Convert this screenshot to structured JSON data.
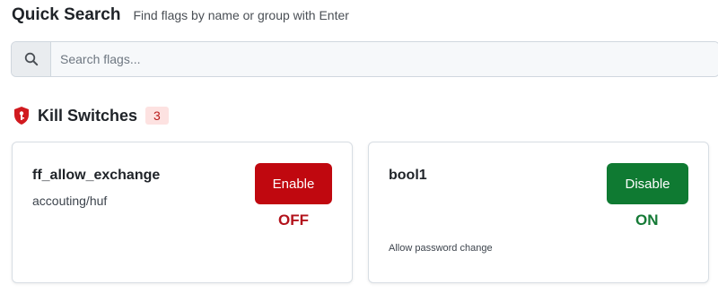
{
  "header": {
    "title": "Quick Search",
    "subtitle": "Find flags by name or group with Enter"
  },
  "search": {
    "icon": "search-icon",
    "placeholder": "Search flags..."
  },
  "section": {
    "icon": "shield-icon",
    "title": "Kill Switches",
    "count": "3"
  },
  "cards": [
    {
      "name": "ff_allow_exchange",
      "group": "accouting/huf",
      "description": "",
      "button_label": "Enable",
      "state": "OFF",
      "button_color": "#c0080f",
      "state_color": "#b3121b"
    },
    {
      "name": "bool1",
      "group": "",
      "description": "Allow password change",
      "button_label": "Disable",
      "state": "ON",
      "button_color": "#0f7a32",
      "state_color": "#157a36"
    }
  ]
}
